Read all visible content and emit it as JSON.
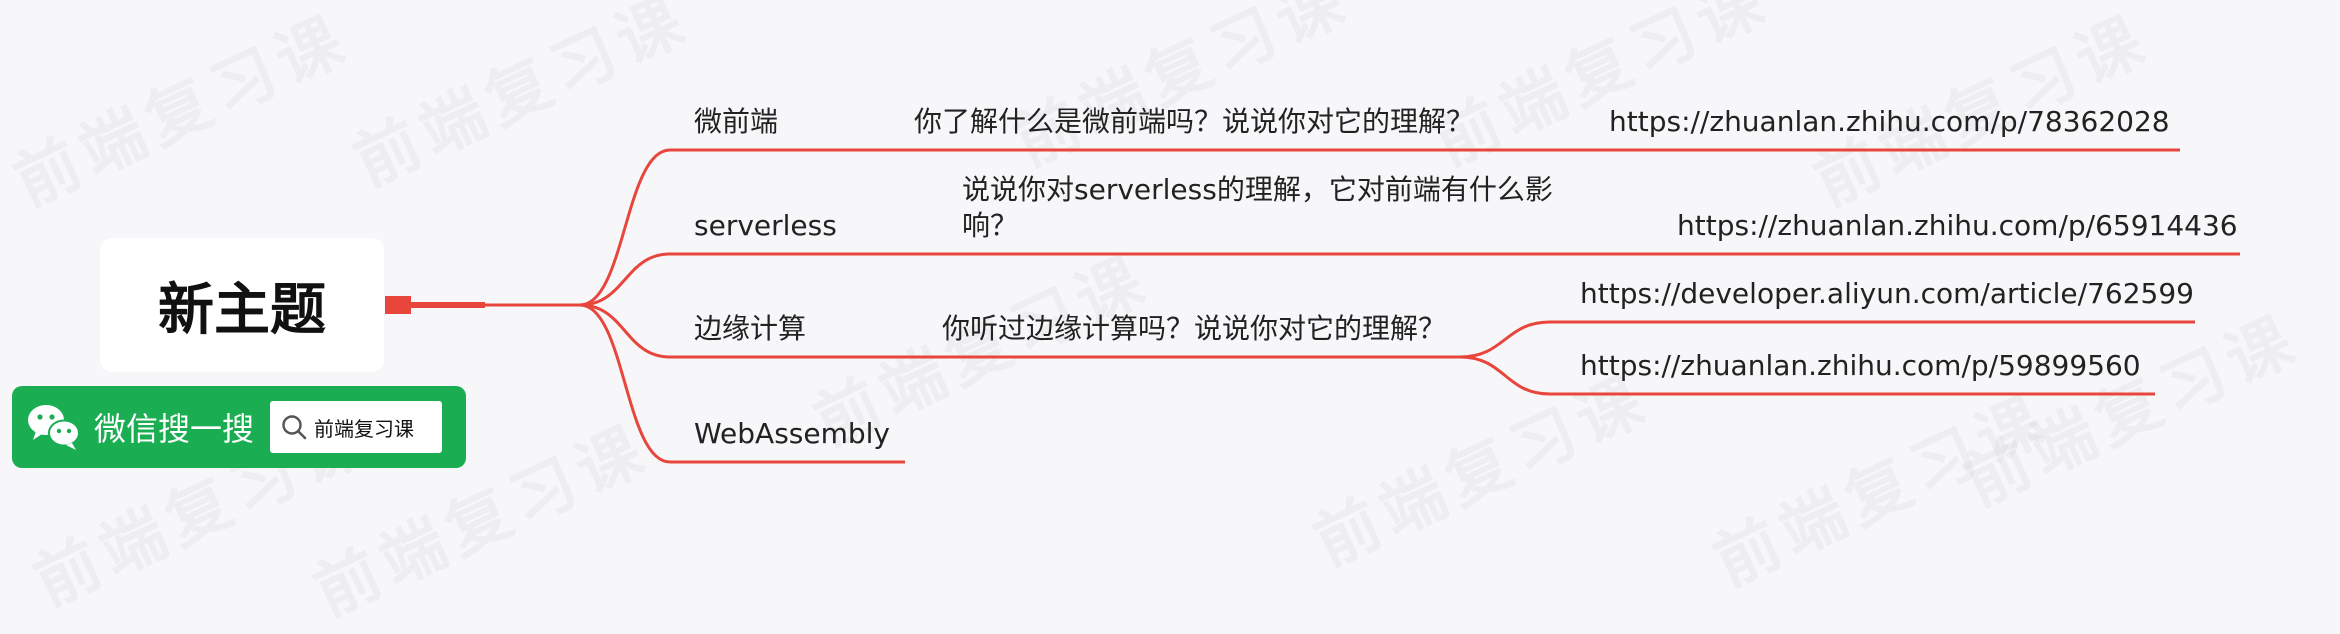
{
  "root": {
    "label": "新主题"
  },
  "branches": [
    {
      "label": "微前端",
      "question": "你了解什么是微前端吗？说说你对它的理解？",
      "links": [
        "https://zhuanlan.zhihu.com/p/78362028"
      ]
    },
    {
      "label": "serverless",
      "question": "说说你对serverless的理解，它对前端有什么影响？",
      "links": [
        "https://zhuanlan.zhihu.com/p/65914436"
      ]
    },
    {
      "label": "边缘计算",
      "question": "你听过边缘计算吗？说说你对它的理解？",
      "links": [
        "https://developer.aliyun.com/article/762599",
        "https://zhuanlan.zhihu.com/p/59899560"
      ]
    },
    {
      "label": "WebAssembly",
      "question": "",
      "links": []
    }
  ],
  "badge": {
    "title": "微信搜一搜",
    "query": "前端复习课",
    "icon": "wechat-icon",
    "search_icon": "search-icon"
  },
  "watermark": {
    "text": "前端复习课"
  },
  "colors": {
    "connector": "#e8453c",
    "badge_bg": "#1aad52",
    "background": "#f7f7f9"
  }
}
